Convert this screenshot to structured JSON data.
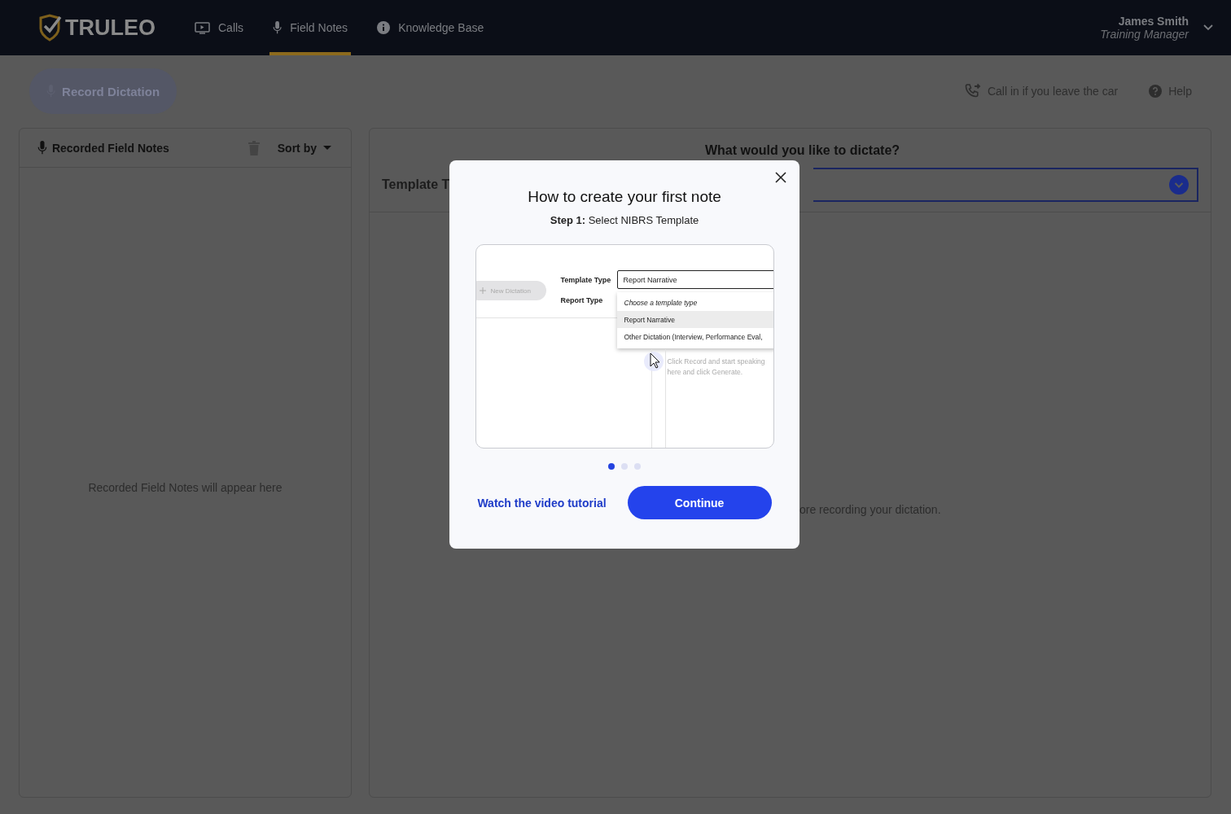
{
  "nav": {
    "logo": "TRULEO",
    "tabs": [
      {
        "label": "Calls",
        "selected": false
      },
      {
        "label": "Field Notes",
        "selected": true
      },
      {
        "label": "Knowledge Base",
        "selected": false
      }
    ],
    "user": {
      "name": "James Smith",
      "role": "Training Manager"
    }
  },
  "toolbar": {
    "record_button": {
      "label": "Record Dictation",
      "disabled": true
    },
    "call_in": "Call in if you leave the car",
    "help": "Help"
  },
  "notes_panel": {
    "title": "Recorded Field Notes",
    "sort": "Sort by",
    "empty": "Recorded Field Notes will appear here"
  },
  "dictation_panel": {
    "question": "What would you like to dictate?",
    "template_label": "Template T",
    "hint": "ore recording your dictation."
  },
  "modal": {
    "title": "How to create your first note",
    "step_label": "Step 1:",
    "step_text": "Select NIBRS Template",
    "preview": {
      "new_button": "New Dictation",
      "template_label": "Template Type",
      "report_label": "Report Type",
      "field_value": "Report Narrative",
      "options": [
        {
          "label": "Choose a template type",
          "kind": "placeholder",
          "selected": false
        },
        {
          "label": "Report Narrative",
          "kind": "option",
          "selected": true
        },
        {
          "label": "Other Dictation (Interview, Performance Eval, ",
          "kind": "option",
          "selected": false
        }
      ],
      "editor_hint": "Click Record and start speaking here and click Generate."
    },
    "dots": [
      {
        "selected": true
      },
      {
        "selected": false
      },
      {
        "selected": false
      }
    ],
    "link": "Watch the video tutorial",
    "continue": "Continue"
  }
}
